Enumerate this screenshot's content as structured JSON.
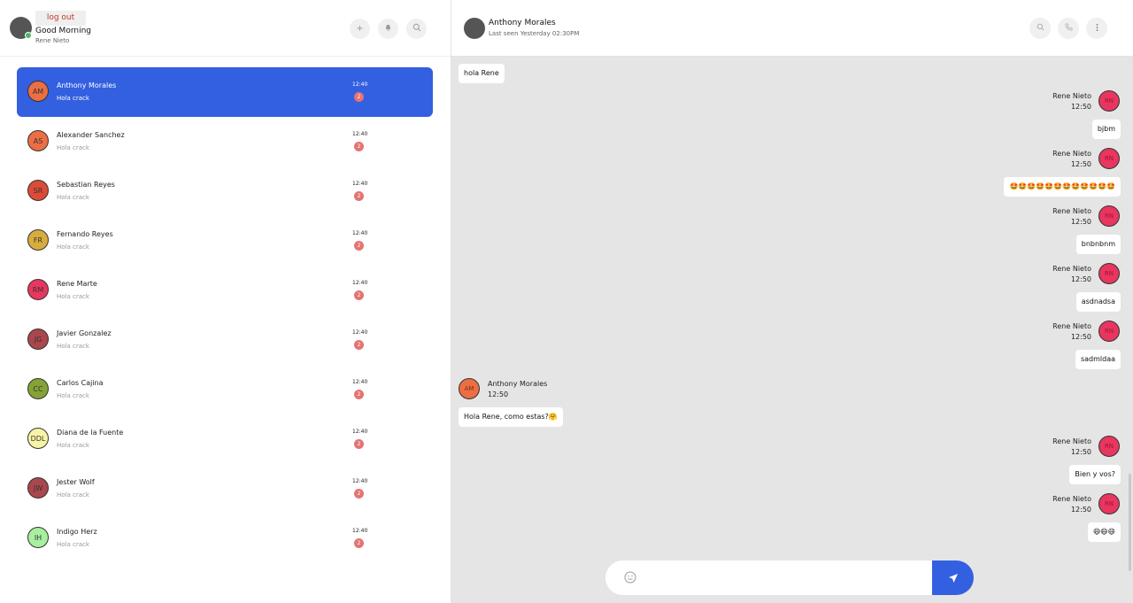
{
  "sidebar": {
    "logout_label": "log out",
    "greeting": "Good Morning",
    "user_name": "Rene Nieto",
    "buttons": {
      "add_icon": "plus-icon",
      "notify_icon": "bell-icon",
      "search_icon": "search-icon"
    }
  },
  "chats": [
    {
      "initials": "AM",
      "name": "Anthony Morales",
      "preview": "Hola crack",
      "time": "12:40",
      "badge": "2",
      "color": "#ec6e44",
      "active": true
    },
    {
      "initials": "AS",
      "name": "Alexander Sanchez",
      "preview": "Hola crack",
      "time": "12:40",
      "badge": "2",
      "color": "#ec6e44"
    },
    {
      "initials": "SR",
      "name": "Sebastian Reyes",
      "preview": "Hola crack",
      "time": "12:40",
      "badge": "2",
      "color": "#dc4b37"
    },
    {
      "initials": "FR",
      "name": "Fernando Reyes",
      "preview": "Hola crack",
      "time": "12:40",
      "badge": "2",
      "color": "#d7ad3e"
    },
    {
      "initials": "RM",
      "name": "Rene Marte",
      "preview": "Hola crack",
      "time": "12:40",
      "badge": "2",
      "color": "#e8365f"
    },
    {
      "initials": "JG",
      "name": "Javier Gonzalez",
      "preview": "Hola crack",
      "time": "12:40",
      "badge": "2",
      "color": "#a9474c"
    },
    {
      "initials": "CC",
      "name": "Carlos Cajina",
      "preview": "Hola crack",
      "time": "12:40",
      "badge": "2",
      "color": "#84a336"
    },
    {
      "initials": "DDL",
      "name": "Diana de la Fuente",
      "preview": "Hola crack",
      "time": "12:40",
      "badge": "2",
      "color": "#f8f4a6"
    },
    {
      "initials": "JW",
      "name": "Jester Wolf",
      "preview": "Hola crack",
      "time": "12:40",
      "badge": "2",
      "color": "#a9474c"
    },
    {
      "initials": "IH",
      "name": "Indigo Herz",
      "preview": "Hola crack",
      "time": "12:40",
      "badge": "2",
      "color": "#a8f0a0"
    }
  ],
  "conversation": {
    "contact_name": "Anthony Morales",
    "status": "Last seen Yesterday 02:30PM",
    "buttons": {
      "search_icon": "search-icon",
      "call_icon": "phone-icon",
      "menu_icon": "more-vertical-icon"
    },
    "messages": [
      {
        "side": "left",
        "text": "hola Rene"
      },
      {
        "side": "right",
        "sender": "Rene Nieto",
        "time": "12:50",
        "initials": "RN",
        "text": "bjbm"
      },
      {
        "side": "right",
        "sender": "Rene Nieto",
        "time": "12:50",
        "initials": "RN",
        "text": "🤩🤩🤩🤩🤩🤩🤩🤩🤩🤩🤩🤩"
      },
      {
        "side": "right",
        "sender": "Rene Nieto",
        "time": "12:50",
        "initials": "RN",
        "text": "bnbnbnm"
      },
      {
        "side": "right",
        "sender": "Rene Nieto",
        "time": "12:50",
        "initials": "RN",
        "text": "asdnadsa"
      },
      {
        "side": "right",
        "sender": "Rene Nieto",
        "time": "12:50",
        "initials": "RN",
        "text": "sadmldaa"
      },
      {
        "side": "left",
        "sender": "Anthony Morales",
        "time": "12:50",
        "initials": "AM",
        "text": "Hola Rene, como estas?🤗"
      },
      {
        "side": "right",
        "sender": "Rene Nieto",
        "time": "12:50",
        "initials": "RN",
        "text": "Bien y vos?"
      },
      {
        "side": "right",
        "sender": "Rene Nieto",
        "time": "12:50",
        "initials": "RN",
        "text": "😄😄😄"
      }
    ],
    "rn_color": "#e8365f",
    "am_color": "#ec6e44"
  },
  "composer": {
    "placeholder": "",
    "emoji_icon": "smile-icon",
    "send_icon": "send-icon"
  }
}
